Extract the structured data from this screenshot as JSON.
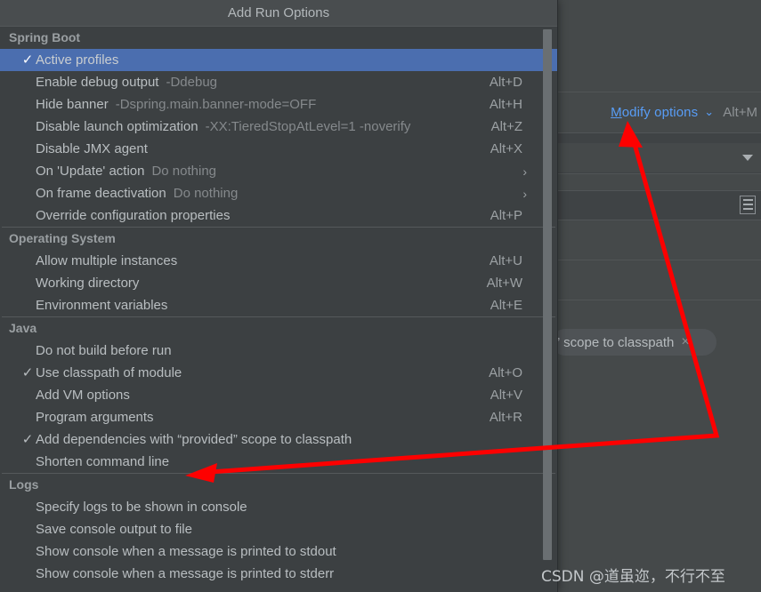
{
  "menu": {
    "title": "Add Run Options",
    "groups": [
      {
        "header": "Spring Boot",
        "items": [
          {
            "label": "Active profiles",
            "hint": "",
            "shortcut": "",
            "checked": true,
            "selected": true,
            "submenu": false
          },
          {
            "label": "Enable debug output",
            "hint": "-Ddebug",
            "shortcut": "Alt+D",
            "checked": false,
            "selected": false,
            "submenu": false
          },
          {
            "label": "Hide banner",
            "hint": "-Dspring.main.banner-mode=OFF",
            "shortcut": "Alt+H",
            "checked": false,
            "selected": false,
            "submenu": false
          },
          {
            "label": "Disable launch optimization",
            "hint": "-XX:TieredStopAtLevel=1 -noverify",
            "shortcut": "Alt+Z",
            "checked": false,
            "selected": false,
            "submenu": false
          },
          {
            "label": "Disable JMX agent",
            "hint": "",
            "shortcut": "Alt+X",
            "checked": false,
            "selected": false,
            "submenu": false
          },
          {
            "label": "On 'Update' action",
            "hint": "Do nothing",
            "shortcut": "",
            "checked": false,
            "selected": false,
            "submenu": true
          },
          {
            "label": "On frame deactivation",
            "hint": "Do nothing",
            "shortcut": "",
            "checked": false,
            "selected": false,
            "submenu": true
          },
          {
            "label": "Override configuration properties",
            "hint": "",
            "shortcut": "Alt+P",
            "checked": false,
            "selected": false,
            "submenu": false
          }
        ]
      },
      {
        "header": "Operating System",
        "items": [
          {
            "label": "Allow multiple instances",
            "hint": "",
            "shortcut": "Alt+U",
            "checked": false,
            "selected": false,
            "submenu": false
          },
          {
            "label": "Working directory",
            "hint": "",
            "shortcut": "Alt+W",
            "checked": false,
            "selected": false,
            "submenu": false
          },
          {
            "label": "Environment variables",
            "hint": "",
            "shortcut": "Alt+E",
            "checked": false,
            "selected": false,
            "submenu": false
          }
        ]
      },
      {
        "header": "Java",
        "items": [
          {
            "label": "Do not build before run",
            "hint": "",
            "shortcut": "",
            "checked": false,
            "selected": false,
            "submenu": false
          },
          {
            "label": "Use classpath of module",
            "hint": "",
            "shortcut": "Alt+O",
            "checked": true,
            "selected": false,
            "submenu": false
          },
          {
            "label": "Add VM options",
            "hint": "",
            "shortcut": "Alt+V",
            "checked": false,
            "selected": false,
            "submenu": false
          },
          {
            "label": "Program arguments",
            "hint": "",
            "shortcut": "Alt+R",
            "checked": false,
            "selected": false,
            "submenu": false
          },
          {
            "label": "Add dependencies with “provided” scope to classpath",
            "hint": "",
            "shortcut": "",
            "checked": true,
            "selected": false,
            "submenu": false
          },
          {
            "label": "Shorten command line",
            "hint": "",
            "shortcut": "",
            "checked": false,
            "selected": false,
            "submenu": false
          }
        ]
      },
      {
        "header": "Logs",
        "items": [
          {
            "label": "Specify logs to be shown in console",
            "hint": "",
            "shortcut": "",
            "checked": false,
            "selected": false,
            "submenu": false
          },
          {
            "label": "Save console output to file",
            "hint": "",
            "shortcut": "",
            "checked": false,
            "selected": false,
            "submenu": false
          },
          {
            "label": "Show console when a message is printed to stdout",
            "hint": "",
            "shortcut": "",
            "checked": false,
            "selected": false,
            "submenu": false
          },
          {
            "label": "Show console when a message is printed to stderr",
            "hint": "",
            "shortcut": "",
            "checked": false,
            "selected": false,
            "submenu": false
          }
        ]
      }
    ],
    "check_glyph": "✓",
    "submenu_glyph": "›"
  },
  "background": {
    "modify_options": {
      "mnemonic": "M",
      "rest": "odify options",
      "chevron": "⌄",
      "shortcut": "Alt+M"
    },
    "classpath_chip": {
      "label": "” scope to classpath",
      "close_glyph": "×"
    }
  },
  "annotation": {
    "color": "#fe0000"
  },
  "watermark": {
    "text": "CSDN @道虽迩，不行不至"
  },
  "colors": {
    "menu_background": "#3c4042",
    "menu_titlebar": "#494d4f",
    "selection_blue": "#4b6eaf",
    "link_blue": "#589df6",
    "text_primary": "#b9bec1",
    "text_dim": "#85898c",
    "panel_background": "#45494a",
    "annotation_red": "#fe0000"
  }
}
